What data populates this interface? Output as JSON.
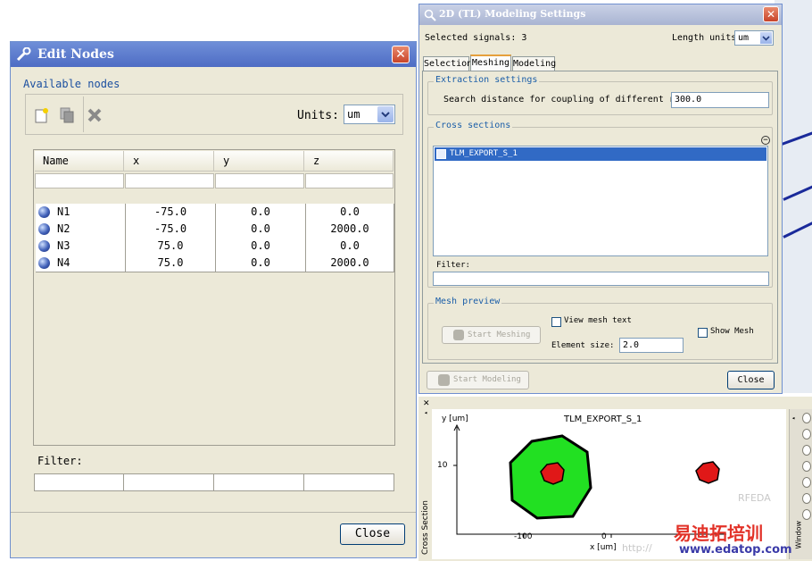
{
  "edit_nodes": {
    "title": "Edit Nodes",
    "group_label": "Available nodes",
    "units_label": "Units:",
    "units_value": "um",
    "columns": [
      "Name",
      "x",
      "y",
      "z"
    ],
    "rows": [
      {
        "name": "N1",
        "x": "-75.0",
        "y": "0.0",
        "z": "0.0"
      },
      {
        "name": "N2",
        "x": "-75.0",
        "y": "0.0",
        "z": "2000.0"
      },
      {
        "name": "N3",
        "x": "75.0",
        "y": "0.0",
        "z": "0.0"
      },
      {
        "name": "N4",
        "x": "75.0",
        "y": "0.0",
        "z": "2000.0"
      }
    ],
    "filter_label": "Filter:",
    "close_label": "Close",
    "toolbar_icons": [
      "new-node-icon",
      "copy-node-icon",
      "delete-node-icon"
    ]
  },
  "modeling": {
    "title": "2D (TL) Modeling Settings",
    "selected_signals": "Selected signals: 3",
    "length_units_label": "Length units:",
    "length_units_value": "um",
    "tabs": [
      "Selection",
      "Meshing",
      "Modeling"
    ],
    "active_tab": "Meshing",
    "extraction_title": "Extraction settings",
    "search_distance_label": "Search distance for coupling of different routes:",
    "search_distance_value": "300.0",
    "cross_sections_title": "Cross sections",
    "cross_section_item": "TLM_EXPORT_S_1",
    "filter_label": "Filter:",
    "mesh_preview_title": "Mesh preview",
    "start_meshing": "Start Meshing",
    "view_mesh_text": "View mesh text",
    "show_mesh": "Show Mesh",
    "element_size_label": "Element size:",
    "element_size_value": "2.0",
    "start_modeling": "Start Modeling",
    "close_label": "Close"
  },
  "cross_section_panel": {
    "side_label": "Cross Section",
    "plot_title": "TLM_EXPORT_S_1",
    "y_axis_label": "y [um]",
    "x_axis_label": "x [um]",
    "y_tick": "10",
    "x_ticks": [
      "-100",
      "0"
    ],
    "watermark_site": "RFEDA",
    "watermark_cn": "易迪拓培训",
    "watermark_url": "www.edatop.com",
    "watermark_http": "http://",
    "right_panel_label": "Window",
    "colors": {
      "conductor_fill": "#22e022",
      "conductor_edge": "#000000",
      "signal": "#e01818"
    }
  }
}
